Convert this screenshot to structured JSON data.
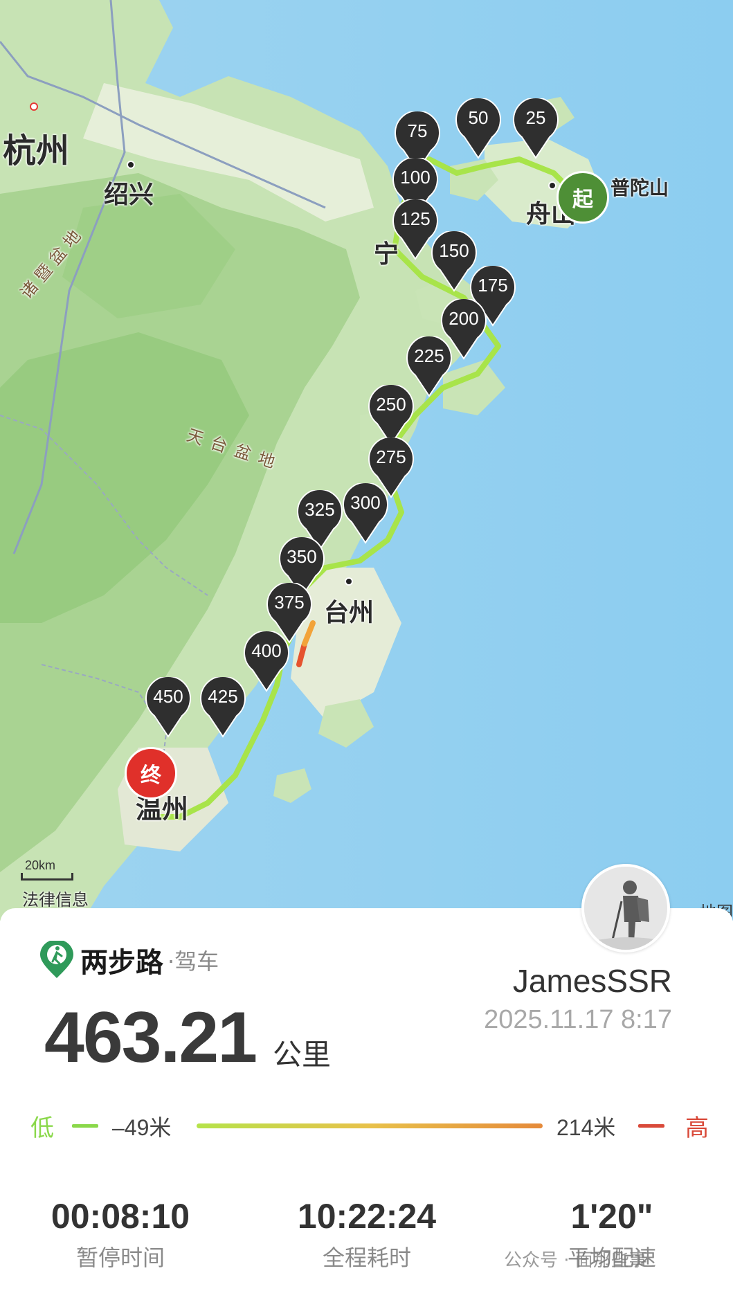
{
  "map": {
    "cities": [
      {
        "name": "杭州",
        "size": 48
      },
      {
        "name": "绍兴",
        "size": 36
      },
      {
        "name": "宁",
        "size": 36
      },
      {
        "name": "舟山",
        "size": 36
      },
      {
        "name": "普陀山",
        "size": 28
      },
      {
        "name": "台州",
        "size": 36
      },
      {
        "name": "温州",
        "size": 38
      }
    ],
    "regions": [
      "诸暨盆地",
      "天台盆地"
    ],
    "markers": [
      "25",
      "50",
      "75",
      "100",
      "125",
      "150",
      "175",
      "200",
      "225",
      "250",
      "275",
      "300",
      "325",
      "350",
      "375",
      "400",
      "425",
      "450"
    ],
    "start_label": "起",
    "end_label": "终",
    "scale": "20km",
    "legal": "法律信息",
    "source": "地图",
    "colors": {
      "start": "#4e8f36",
      "end": "#e0302a",
      "marker": "#2f2f2f",
      "route_low": "#a8e44a",
      "route_high": "#e5532f"
    }
  },
  "header": {
    "app_name": "两步路",
    "mode": "·驾车",
    "username": "JamesSSR",
    "datetime": "2025.11.17 8:17"
  },
  "summary": {
    "distance": "463.21",
    "distance_unit": "公里"
  },
  "elevation": {
    "low_label": "低",
    "high_label": "高",
    "min": "–49米",
    "max": "214米"
  },
  "stats": [
    {
      "value": "00:08:10",
      "label": "暂停时间"
    },
    {
      "value": "10:22:24",
      "label": "全程耗时"
    },
    {
      "value": "1'20\"",
      "label": "平均配速"
    }
  ],
  "watermark": "公众号 · 面那些事"
}
